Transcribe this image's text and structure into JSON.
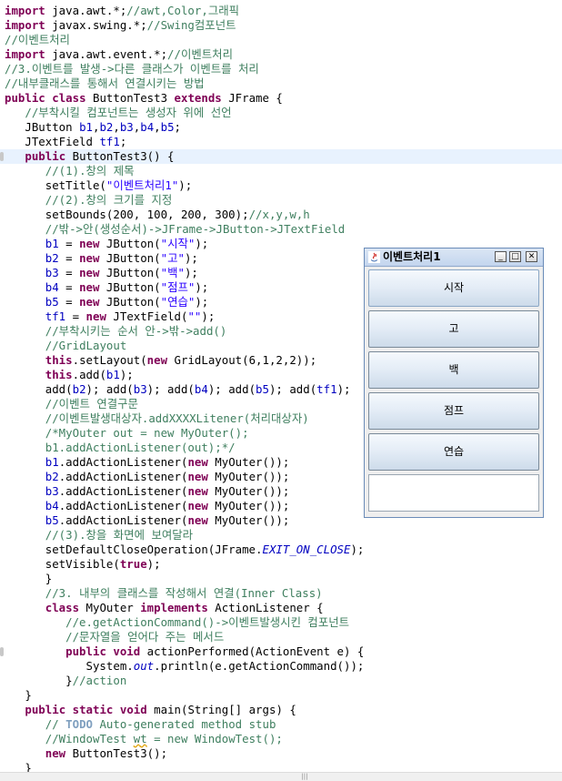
{
  "editor": {
    "lines": [
      [
        [
          "import",
          "kw"
        ],
        [
          " java.awt.*;",
          ""
        ],
        [
          "//awt,Color,그래픽",
          "cm"
        ]
      ],
      [
        [
          "import",
          "kw"
        ],
        [
          " javax.swing.*;",
          ""
        ],
        [
          "//Swing컴포넌트",
          "cm"
        ]
      ],
      [
        [
          "//이벤트처리",
          "cm"
        ]
      ],
      [
        [
          "import",
          "kw"
        ],
        [
          " java.awt.event.*;",
          ""
        ],
        [
          "//이벤트처리",
          "cm"
        ]
      ],
      [
        [
          "//3.이벤트를 발생->다른 클래스가 이벤트를 처리",
          "cm"
        ]
      ],
      [
        [
          "//내부클래스를 통해서 연결시키는 방법",
          "cm"
        ]
      ],
      [
        [
          "public",
          "kw"
        ],
        [
          " ",
          ""
        ],
        [
          "class",
          "kw"
        ],
        [
          " ButtonTest3 ",
          ""
        ],
        [
          "extends",
          "kw"
        ],
        [
          " JFrame {",
          ""
        ]
      ],
      [
        [
          "   ",
          ""
        ],
        [
          "//부착시킬 컴포넌트는 생성자 위에 선언",
          "cm"
        ]
      ],
      [
        [
          "   JButton ",
          ""
        ],
        [
          "b1",
          "fld"
        ],
        [
          ",",
          ""
        ],
        [
          "b2",
          "fld"
        ],
        [
          ",",
          ""
        ],
        [
          "b3",
          "fld"
        ],
        [
          ",",
          ""
        ],
        [
          "b4",
          "fld"
        ],
        [
          ",",
          ""
        ],
        [
          "b5",
          "fld"
        ],
        [
          ";",
          ""
        ]
      ],
      [
        [
          "   JTextField ",
          ""
        ],
        [
          "tf1",
          "fld"
        ],
        [
          ";",
          ""
        ]
      ],
      [
        [
          "   ",
          ""
        ],
        [
          "public",
          "kw"
        ],
        [
          " ButtonTest3() {",
          ""
        ]
      ],
      [
        [
          "      ",
          ""
        ],
        [
          "//(1).창의 제목",
          "cm"
        ]
      ],
      [
        [
          "      setTitle(",
          ""
        ],
        [
          "\"이벤트처리1\"",
          "str"
        ],
        [
          ");",
          ""
        ]
      ],
      [
        [
          "      ",
          ""
        ],
        [
          "//(2).창의 크기를 지정",
          "cm"
        ]
      ],
      [
        [
          "      setBounds(200, 100, 200, 300);",
          ""
        ],
        [
          "//x,y,w,h",
          "cm"
        ]
      ],
      [
        [
          "      ",
          ""
        ],
        [
          "//밖->안(생성순서)->JFrame->JButton->JTextField",
          "cm"
        ]
      ],
      [
        [
          "      ",
          ""
        ],
        [
          "b1",
          "fld"
        ],
        [
          " = ",
          ""
        ],
        [
          "new",
          "kw"
        ],
        [
          " JButton(",
          ""
        ],
        [
          "\"시작\"",
          "str"
        ],
        [
          ");",
          ""
        ]
      ],
      [
        [
          "      ",
          ""
        ],
        [
          "b2",
          "fld"
        ],
        [
          " = ",
          ""
        ],
        [
          "new",
          "kw"
        ],
        [
          " JButton(",
          ""
        ],
        [
          "\"고\"",
          "str"
        ],
        [
          ");",
          ""
        ]
      ],
      [
        [
          "      ",
          ""
        ],
        [
          "b3",
          "fld"
        ],
        [
          " = ",
          ""
        ],
        [
          "new",
          "kw"
        ],
        [
          " JButton(",
          ""
        ],
        [
          "\"백\"",
          "str"
        ],
        [
          ");",
          ""
        ]
      ],
      [
        [
          "      ",
          ""
        ],
        [
          "b4",
          "fld"
        ],
        [
          " = ",
          ""
        ],
        [
          "new",
          "kw"
        ],
        [
          " JButton(",
          ""
        ],
        [
          "\"점프\"",
          "str"
        ],
        [
          ");",
          ""
        ]
      ],
      [
        [
          "      ",
          ""
        ],
        [
          "b5",
          "fld"
        ],
        [
          " = ",
          ""
        ],
        [
          "new",
          "kw"
        ],
        [
          " JButton(",
          ""
        ],
        [
          "\"연습\"",
          "str"
        ],
        [
          ");",
          ""
        ]
      ],
      [
        [
          "      ",
          ""
        ],
        [
          "tf1",
          "fld"
        ],
        [
          " = ",
          ""
        ],
        [
          "new",
          "kw"
        ],
        [
          " JTextField(",
          ""
        ],
        [
          "\"\"",
          "str"
        ],
        [
          ");",
          ""
        ]
      ],
      [
        [
          "      ",
          ""
        ],
        [
          "//부착시키는 순서 안->밖->add()",
          "cm"
        ]
      ],
      [
        [
          "      ",
          ""
        ],
        [
          "//GridLayout",
          "cm"
        ]
      ],
      [
        [
          "      ",
          ""
        ],
        [
          "this",
          "kw"
        ],
        [
          ".setLayout(",
          ""
        ],
        [
          "new",
          "kw"
        ],
        [
          " GridLayout(6,1,2,2));",
          ""
        ]
      ],
      [
        [
          "      ",
          ""
        ],
        [
          "this",
          "kw"
        ],
        [
          ".add(",
          ""
        ],
        [
          "b1",
          "fld"
        ],
        [
          ");",
          ""
        ]
      ],
      [
        [
          "      add(",
          ""
        ],
        [
          "b2",
          "fld"
        ],
        [
          "); add(",
          ""
        ],
        [
          "b3",
          "fld"
        ],
        [
          "); add(",
          ""
        ],
        [
          "b4",
          "fld"
        ],
        [
          "); add(",
          ""
        ],
        [
          "b5",
          "fld"
        ],
        [
          "); add(",
          ""
        ],
        [
          "tf1",
          "fld"
        ],
        [
          ");",
          ""
        ]
      ],
      [
        [
          "      ",
          ""
        ],
        [
          "//이벤트 연결구문",
          "cm"
        ]
      ],
      [
        [
          "      ",
          ""
        ],
        [
          "//이벤트발생대상자.addXXXXLitener(처리대상자)",
          "cm"
        ]
      ],
      [
        [
          "      ",
          ""
        ],
        [
          "/*MyOuter out = new MyOuter();",
          "cm"
        ]
      ],
      [
        [
          "      ",
          ""
        ],
        [
          "b1.addActionListener(out);*/",
          "cm"
        ]
      ],
      [
        [
          "      ",
          ""
        ],
        [
          "b1",
          "fld"
        ],
        [
          ".addActionListener(",
          ""
        ],
        [
          "new",
          "kw"
        ],
        [
          " MyOuter());",
          ""
        ]
      ],
      [
        [
          "      ",
          ""
        ],
        [
          "b2",
          "fld"
        ],
        [
          ".addActionListener(",
          ""
        ],
        [
          "new",
          "kw"
        ],
        [
          " MyOuter());",
          ""
        ]
      ],
      [
        [
          "      ",
          ""
        ],
        [
          "b3",
          "fld"
        ],
        [
          ".addActionListener(",
          ""
        ],
        [
          "new",
          "kw"
        ],
        [
          " MyOuter());",
          ""
        ]
      ],
      [
        [
          "      ",
          ""
        ],
        [
          "b4",
          "fld"
        ],
        [
          ".addActionListener(",
          ""
        ],
        [
          "new",
          "kw"
        ],
        [
          " MyOuter());",
          ""
        ]
      ],
      [
        [
          "      ",
          ""
        ],
        [
          "b5",
          "fld"
        ],
        [
          ".addActionListener(",
          ""
        ],
        [
          "new",
          "kw"
        ],
        [
          " MyOuter());",
          ""
        ]
      ],
      [
        [
          "      ",
          ""
        ],
        [
          "//(3).창을 화면에 보여달라",
          "cm"
        ]
      ],
      [
        [
          "      setDefaultCloseOperation(JFrame.",
          ""
        ],
        [
          "EXIT_ON_CLOSE",
          "sfld"
        ],
        [
          ");",
          ""
        ]
      ],
      [
        [
          "      setVisible(",
          ""
        ],
        [
          "true",
          "kw"
        ],
        [
          ");",
          ""
        ]
      ],
      [
        [
          "      }",
          ""
        ]
      ],
      [
        [
          "      ",
          ""
        ],
        [
          "//3. 내부의 클래스를 작성해서 연결(Inner Class)",
          "cm"
        ]
      ],
      [
        [
          "      ",
          ""
        ],
        [
          "class",
          "kw"
        ],
        [
          " MyOuter ",
          ""
        ],
        [
          "implements",
          "kw"
        ],
        [
          " ActionListener {",
          ""
        ]
      ],
      [
        [
          "         ",
          ""
        ],
        [
          "//e.getActionCommand()->이벤트발생시킨 컴포넌트",
          "cm"
        ]
      ],
      [
        [
          "         ",
          ""
        ],
        [
          "//문자열을 얻어다 주는 메서드",
          "cm"
        ]
      ],
      [
        [
          "         ",
          ""
        ],
        [
          "public",
          "kw"
        ],
        [
          " ",
          ""
        ],
        [
          "void",
          "kw"
        ],
        [
          " actionPerformed(ActionEvent e) {",
          ""
        ]
      ],
      [
        [
          "            System.",
          ""
        ],
        [
          "out",
          "sfld"
        ],
        [
          ".println(e.getActionCommand());",
          ""
        ]
      ],
      [
        [
          "         }",
          ""
        ],
        [
          "//action",
          "cm"
        ]
      ],
      [
        [
          "   }",
          ""
        ]
      ],
      [
        [
          "   ",
          ""
        ],
        [
          "public",
          "kw"
        ],
        [
          " ",
          ""
        ],
        [
          "static",
          "kw"
        ],
        [
          " ",
          ""
        ],
        [
          "void",
          "kw"
        ],
        [
          " main(String[] args) {",
          ""
        ]
      ],
      [
        [
          "      ",
          ""
        ],
        [
          "// ",
          "cm"
        ],
        [
          "TODO",
          "todo"
        ],
        [
          " Auto-generated method stub",
          "cm"
        ]
      ],
      [
        [
          "      ",
          ""
        ],
        [
          "//WindowTest ",
          "cm"
        ],
        [
          "wt",
          "cmwavy"
        ],
        [
          " = new WindowTest();",
          "cm"
        ]
      ],
      [
        [
          "      ",
          ""
        ],
        [
          "new",
          "kw"
        ],
        [
          " ButtonTest3();",
          ""
        ]
      ],
      [
        [
          "   }",
          ""
        ]
      ]
    ]
  },
  "window": {
    "title": "이벤트처리1",
    "minimize_glyph": "_",
    "maximize_glyph": "□",
    "close_glyph": "✕",
    "buttons": [
      "시작",
      "고",
      "백",
      "점프",
      "연습"
    ],
    "text_field_value": ""
  },
  "scrollbar": {
    "grip_glyph": "|||"
  }
}
